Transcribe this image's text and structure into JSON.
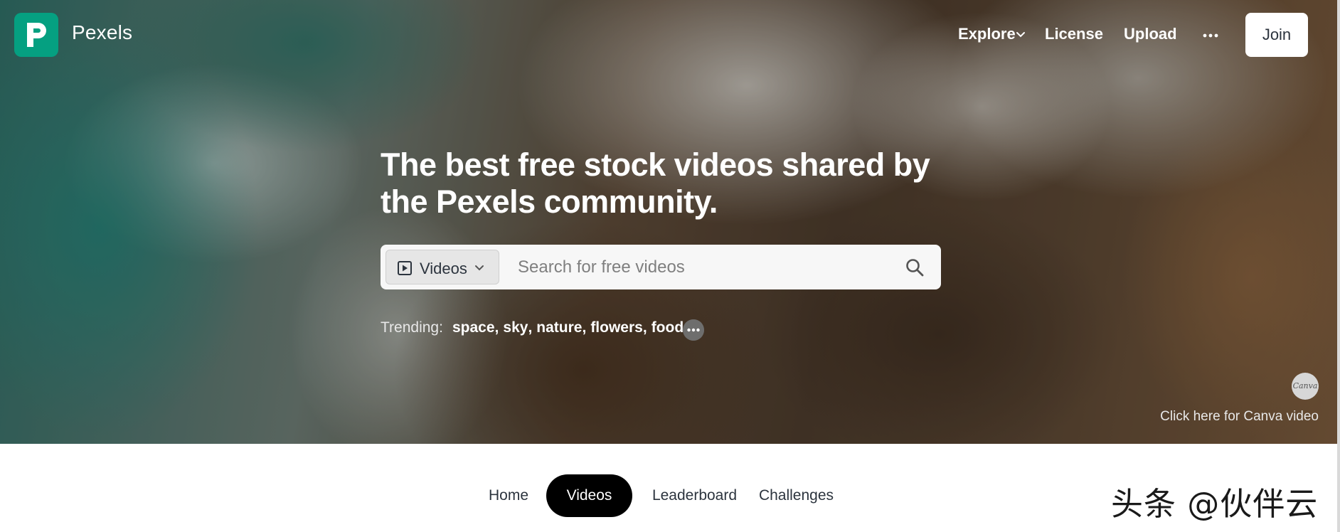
{
  "header": {
    "brand": "Pexels",
    "nav": {
      "explore": "Explore",
      "license": "License",
      "upload": "Upload",
      "join": "Join"
    }
  },
  "hero": {
    "headline": "The best free stock videos shared by the Pexels community.",
    "search": {
      "type_selected": "Videos",
      "placeholder": "Search for free videos"
    },
    "trending": {
      "label": "Trending:",
      "items": [
        "space",
        "sky",
        "nature",
        "flowers",
        "food"
      ]
    },
    "canva": {
      "badge": "Canva",
      "link_text": "Click here for Canva video"
    }
  },
  "tabs": {
    "home": "Home",
    "videos": "Videos",
    "leaderboard": "Leaderboard",
    "challenges": "Challenges",
    "active": "Videos"
  },
  "watermark": "头条 @伙伴云",
  "colors": {
    "brand": "#05a081",
    "active_tab_bg": "#000000",
    "text_dark": "#2c343e"
  }
}
